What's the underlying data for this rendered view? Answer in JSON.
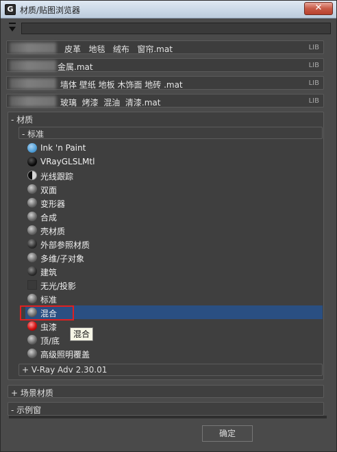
{
  "window": {
    "title": "材质/贴图浏览器",
    "close_label": "✕"
  },
  "search": {
    "value": ""
  },
  "libraries": [
    {
      "name": "皮革   地毯   绒布   窗帘.mat",
      "tag": "LIB"
    },
    {
      "name": "金属.mat",
      "tag": "LIB"
    },
    {
      "name": "墙体 壁纸 地板 木饰面 地砖 .mat",
      "tag": "LIB"
    },
    {
      "name": "玻璃  烤漆  混油  清漆.mat",
      "tag": "LIB"
    }
  ],
  "materials_group": {
    "label": "- 材质",
    "standard_label": "- 标准",
    "items": [
      {
        "label": "Ink 'n Paint",
        "swatch": "blue"
      },
      {
        "label": "VRayGLSLMtl",
        "swatch": "black"
      },
      {
        "label": "光线跟踪",
        "swatch": "half"
      },
      {
        "label": "双面",
        "swatch": "gray"
      },
      {
        "label": "变形器",
        "swatch": "gray"
      },
      {
        "label": "合成",
        "swatch": "gray"
      },
      {
        "label": "壳材质",
        "swatch": "gray"
      },
      {
        "label": "外部参照材质",
        "swatch": "dark"
      },
      {
        "label": "多维/子对象",
        "swatch": "gray"
      },
      {
        "label": "建筑",
        "swatch": "dark"
      },
      {
        "label": "无光/投影",
        "swatch": "square"
      },
      {
        "label": "标准",
        "swatch": "gray"
      },
      {
        "label": "混合",
        "swatch": "gray",
        "selected": true
      },
      {
        "label": "虫漆",
        "swatch": "red"
      },
      {
        "label": "顶/底",
        "swatch": "gray"
      },
      {
        "label": "高级照明覆盖",
        "swatch": "gray"
      }
    ],
    "vray_label": "+ V-Ray Adv 2.30.01"
  },
  "tooltip": "混合",
  "scene_materials_label": "+ 场景材质",
  "sample_slots_label": "- 示例窗",
  "ok_label": "确定"
}
